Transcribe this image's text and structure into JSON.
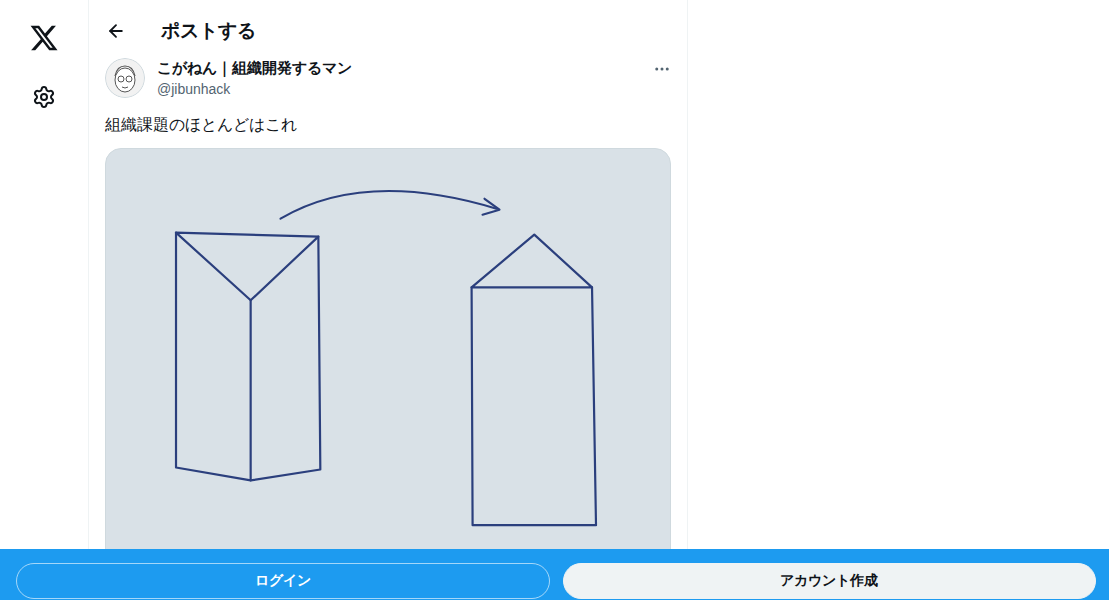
{
  "header": {
    "title": "ポストする"
  },
  "post": {
    "author": {
      "name": "こがねん｜組織開発するマン",
      "handle": "@jibunhack"
    },
    "text": "組織課題のほとんどはこれ"
  },
  "bottom_bar": {
    "buttons": [
      {
        "label": "ログイン",
        "kind": "outline"
      },
      {
        "label": "アカウント作成",
        "kind": "filled"
      }
    ]
  }
}
